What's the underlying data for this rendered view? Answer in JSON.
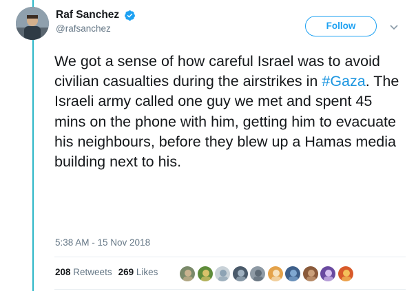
{
  "author": {
    "display_name": "Raf Sanchez",
    "handle": "@rafsanchez",
    "verified_icon": "verified-badge-icon"
  },
  "follow_button": {
    "label": "Follow"
  },
  "menu_caret": {
    "icon": "chevron-down-icon"
  },
  "tweet": {
    "text_before_hashtag": "We got a sense of how careful Israel was to avoid civilian casualties during the airstrikes in ",
    "hashtag": "#Gaza",
    "text_after_hashtag": ". The Israeli army called one guy we met and spent 45 mins on the phone with him, getting him to evacuate his neighbours, before they blew up a Hamas media building next to his."
  },
  "timestamp": "5:38 AM - 15 Nov 2018",
  "stats": {
    "retweets_count": "208",
    "retweets_label": "Retweets",
    "likes_count": "269",
    "likes_label": "Likes"
  },
  "colors": {
    "accent": "#1da1f2",
    "hashtag": "#1b95e0",
    "thread_line": "#2eb7c8",
    "secondary_text": "#657786"
  },
  "liker_avatars": [
    {
      "colors": [
        "#7a8a6a",
        "#c9b38f"
      ]
    },
    {
      "colors": [
        "#5e8c3a",
        "#d9c26a"
      ]
    },
    {
      "colors": [
        "#c9d2d8",
        "#8da3b4"
      ]
    },
    {
      "colors": [
        "#4a5a6a",
        "#9fb0bf"
      ]
    },
    {
      "colors": [
        "#8e9aa5",
        "#5d6a76"
      ]
    },
    {
      "colors": [
        "#e4a24a",
        "#f7e2bf"
      ]
    },
    {
      "colors": [
        "#3d5f8a",
        "#7fa8d1"
      ]
    },
    {
      "colors": [
        "#8a5a3a",
        "#caa07a"
      ]
    },
    {
      "colors": [
        "#6a4aa0",
        "#d8c2f0"
      ]
    },
    {
      "colors": [
        "#d85a2a",
        "#f4c05a"
      ]
    }
  ]
}
